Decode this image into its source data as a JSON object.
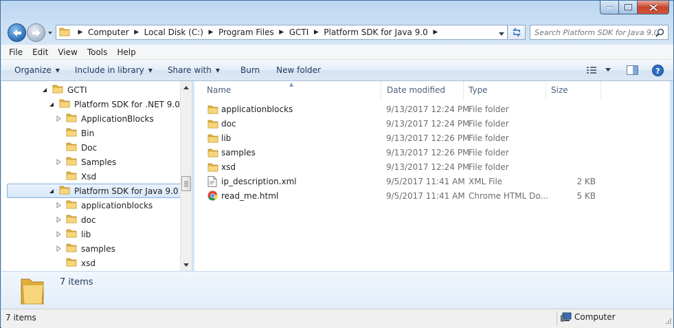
{
  "window": {
    "accent": "#3f6ea0"
  },
  "address": {
    "crumbs": [
      "Computer",
      "Local Disk (C:)",
      "Program Files",
      "GCTI",
      "Platform SDK for Java 9.0"
    ]
  },
  "search": {
    "placeholder": "Search Platform SDK for Java 9.0"
  },
  "menu": {
    "items": [
      "File",
      "Edit",
      "View",
      "Tools",
      "Help"
    ]
  },
  "toolbar": {
    "organize": "Organize",
    "include_in_library": "Include in library",
    "share_with": "Share with",
    "burn": "Burn",
    "new_folder": "New folder"
  },
  "nav_tree": [
    {
      "label": "GCTI",
      "level": 0,
      "expanded": true,
      "icon": "folder-icon"
    },
    {
      "label": "Platform SDK for .NET 9.0",
      "level": 1,
      "expanded": true,
      "icon": "folder-icon"
    },
    {
      "label": "ApplicationBlocks",
      "level": 2,
      "expanded": false,
      "has_children": true,
      "icon": "folder-icon"
    },
    {
      "label": "Bin",
      "level": 2,
      "has_children": false,
      "icon": "folder-icon"
    },
    {
      "label": "Doc",
      "level": 2,
      "has_children": false,
      "icon": "folder-icon"
    },
    {
      "label": "Samples",
      "level": 2,
      "expanded": false,
      "has_children": true,
      "icon": "folder-icon"
    },
    {
      "label": "Xsd",
      "level": 2,
      "has_children": false,
      "icon": "folder-icon"
    },
    {
      "label": "Platform SDK for Java 9.0",
      "level": 1,
      "expanded": true,
      "selected": true,
      "icon": "folder-icon"
    },
    {
      "label": "applicationblocks",
      "level": 2,
      "expanded": false,
      "has_children": true,
      "icon": "folder-icon"
    },
    {
      "label": "doc",
      "level": 2,
      "expanded": false,
      "has_children": true,
      "icon": "folder-icon"
    },
    {
      "label": "lib",
      "level": 2,
      "expanded": false,
      "has_children": true,
      "icon": "folder-icon"
    },
    {
      "label": "samples",
      "level": 2,
      "expanded": false,
      "has_children": true,
      "icon": "folder-icon"
    },
    {
      "label": "xsd",
      "level": 2,
      "has_children": false,
      "icon": "folder-icon"
    }
  ],
  "columns": {
    "name": "Name",
    "date": "Date modified",
    "type": "Type",
    "size": "Size"
  },
  "files": [
    {
      "name": "applicationblocks",
      "date": "9/13/2017 12:24 PM",
      "type": "File folder",
      "size": "",
      "icon": "folder-icon"
    },
    {
      "name": "doc",
      "date": "9/13/2017 12:24 PM",
      "type": "File folder",
      "size": "",
      "icon": "folder-icon"
    },
    {
      "name": "lib",
      "date": "9/13/2017 12:26 PM",
      "type": "File folder",
      "size": "",
      "icon": "folder-icon"
    },
    {
      "name": "samples",
      "date": "9/13/2017 12:26 PM",
      "type": "File folder",
      "size": "",
      "icon": "folder-icon"
    },
    {
      "name": "xsd",
      "date": "9/13/2017 12:24 PM",
      "type": "File folder",
      "size": "",
      "icon": "folder-icon"
    },
    {
      "name": "ip_description.xml",
      "date": "9/5/2017 11:41 AM",
      "type": "XML File",
      "size": "2 KB",
      "icon": "xml-file-icon"
    },
    {
      "name": "read_me.html",
      "date": "9/5/2017 11:41 AM",
      "type": "Chrome HTML Do...",
      "size": "5 KB",
      "icon": "chrome-icon"
    }
  ],
  "details": {
    "count_text": "7 items"
  },
  "status": {
    "left": "7 items",
    "right": "Computer"
  }
}
